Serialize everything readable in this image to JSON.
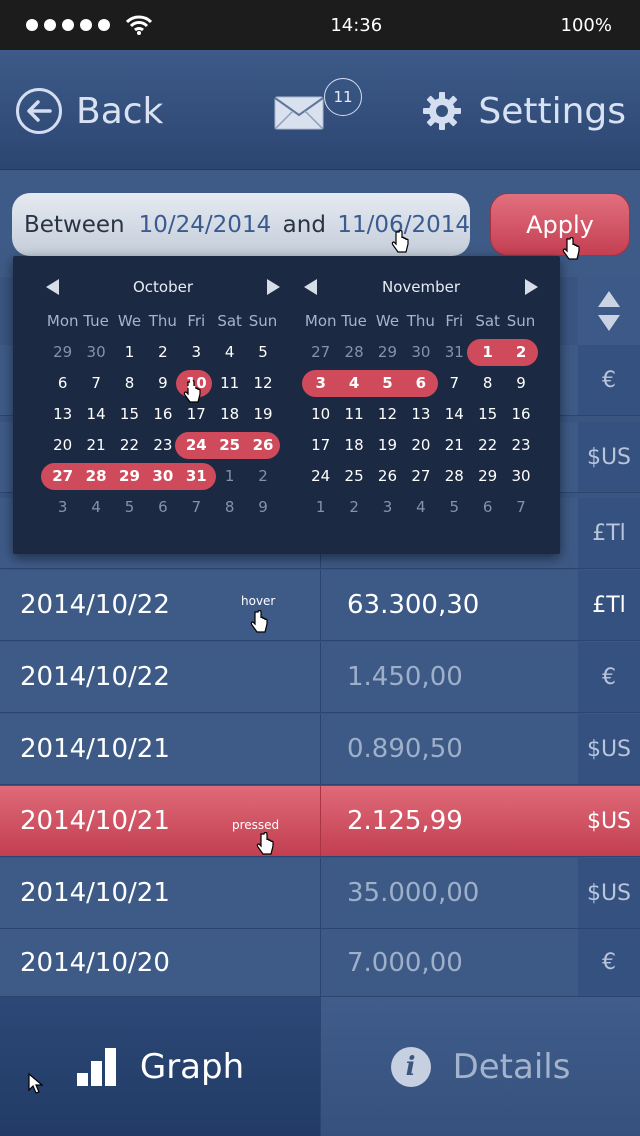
{
  "status_bar": {
    "time": "14:36",
    "battery": "100%"
  },
  "nav": {
    "back_label": "Back",
    "mail_badge": "11",
    "settings_label": "Settings"
  },
  "filter": {
    "between_label": "Between",
    "start_date": "10/24/2014",
    "and_label": "and",
    "end_date": "11/06/2014",
    "apply_label": "Apply"
  },
  "calendar": {
    "weekdays": [
      "Mon",
      "Tue",
      "We",
      "Thu",
      "Fri",
      "Sat",
      "Sun"
    ],
    "months": [
      {
        "name": "October",
        "weeks": [
          [
            "29",
            "30",
            "1",
            "2",
            "3",
            "4",
            "5"
          ],
          [
            "6",
            "7",
            "8",
            "9",
            "10",
            "11",
            "12"
          ],
          [
            "13",
            "14",
            "15",
            "16",
            "17",
            "18",
            "19"
          ],
          [
            "20",
            "21",
            "22",
            "23",
            "24",
            "25",
            "26"
          ],
          [
            "27",
            "28",
            "29",
            "30",
            "31",
            "1",
            "2"
          ],
          [
            "3",
            "4",
            "5",
            "6",
            "7",
            "8",
            "9"
          ]
        ]
      },
      {
        "name": "November",
        "weeks": [
          [
            "27",
            "28",
            "29",
            "30",
            "31",
            "1",
            "2"
          ],
          [
            "3",
            "4",
            "5",
            "6",
            "7",
            "8",
            "9"
          ],
          [
            "10",
            "11",
            "12",
            "13",
            "14",
            "15",
            "16"
          ],
          [
            "17",
            "18",
            "19",
            "20",
            "21",
            "22",
            "23"
          ],
          [
            "24",
            "25",
            "26",
            "27",
            "28",
            "29",
            "30"
          ],
          [
            "1",
            "2",
            "3",
            "4",
            "5",
            "6",
            "7"
          ]
        ]
      }
    ]
  },
  "table": {
    "rows": [
      {
        "date": "",
        "amount": "",
        "currency": "€"
      },
      {
        "date": "",
        "amount": "",
        "currency": "$US"
      },
      {
        "date": "",
        "amount": "",
        "currency": "£Tl"
      },
      {
        "date": "2014/10/22",
        "amount": "63.300,30",
        "currency": "£Tl",
        "note": "hover"
      },
      {
        "date": "2014/10/22",
        "amount": "1.450,00",
        "currency": "€"
      },
      {
        "date": "2014/10/21",
        "amount": "0.890,50",
        "currency": "$US"
      },
      {
        "date": "2014/10/21",
        "amount": "2.125,99",
        "currency": "$US",
        "note": "pressed"
      },
      {
        "date": "2014/10/21",
        "amount": "35.000,00",
        "currency": "$US"
      },
      {
        "date": "2014/10/20",
        "amount": "7.000,00",
        "currency": "€"
      }
    ]
  },
  "tabs": {
    "graph_label": "Graph",
    "details_label": "Details"
  },
  "colors": {
    "accent": "#d04c5d",
    "background": "#3a5580",
    "popup": "#1c2942"
  }
}
